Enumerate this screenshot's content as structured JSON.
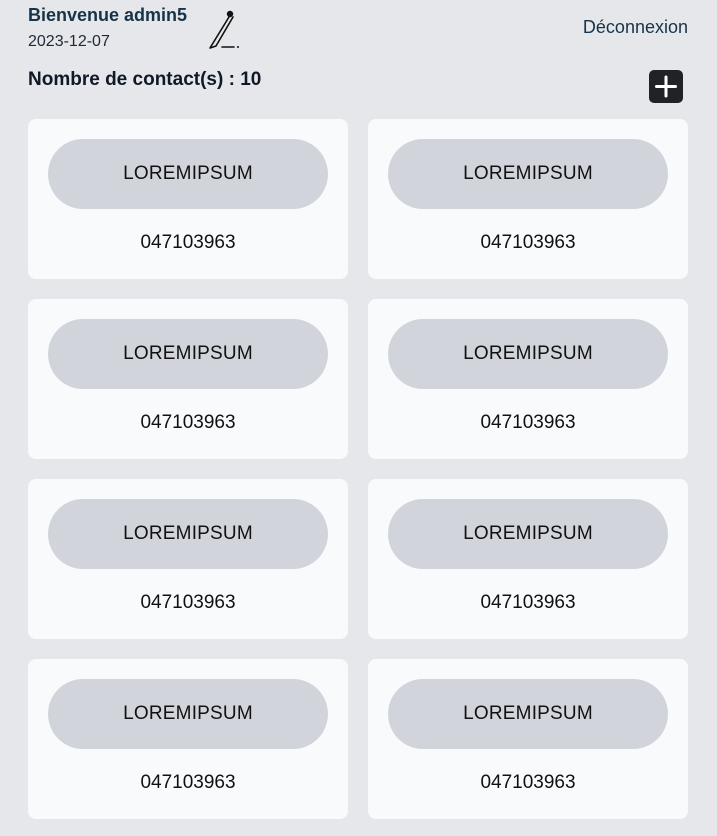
{
  "header": {
    "welcome_label": "Bienvenue",
    "username": "admin5",
    "date": "2023-12-07",
    "logout_label": "Déconnexion",
    "contact_count_label": "Nombre de contact(s) : 10",
    "edit_icon": "pen-signature-icon",
    "add_icon": "plus-icon"
  },
  "contacts": [
    {
      "name": "LOREMIPSUM",
      "phone": "047103963"
    },
    {
      "name": "LOREMIPSUM",
      "phone": "047103963"
    },
    {
      "name": "LOREMIPSUM",
      "phone": "047103963"
    },
    {
      "name": "LOREMIPSUM",
      "phone": "047103963"
    },
    {
      "name": "LOREMIPSUM",
      "phone": "047103963"
    },
    {
      "name": "LOREMIPSUM",
      "phone": "047103963"
    },
    {
      "name": "LOREMIPSUM",
      "phone": "047103963"
    },
    {
      "name": "LOREMIPSUM",
      "phone": "047103963"
    }
  ],
  "colors": {
    "background": "#e5e7eb",
    "card": "#f9fafb",
    "name_pill": "#d1d5db",
    "heading": "#163447",
    "add_button": "#1f2328"
  }
}
